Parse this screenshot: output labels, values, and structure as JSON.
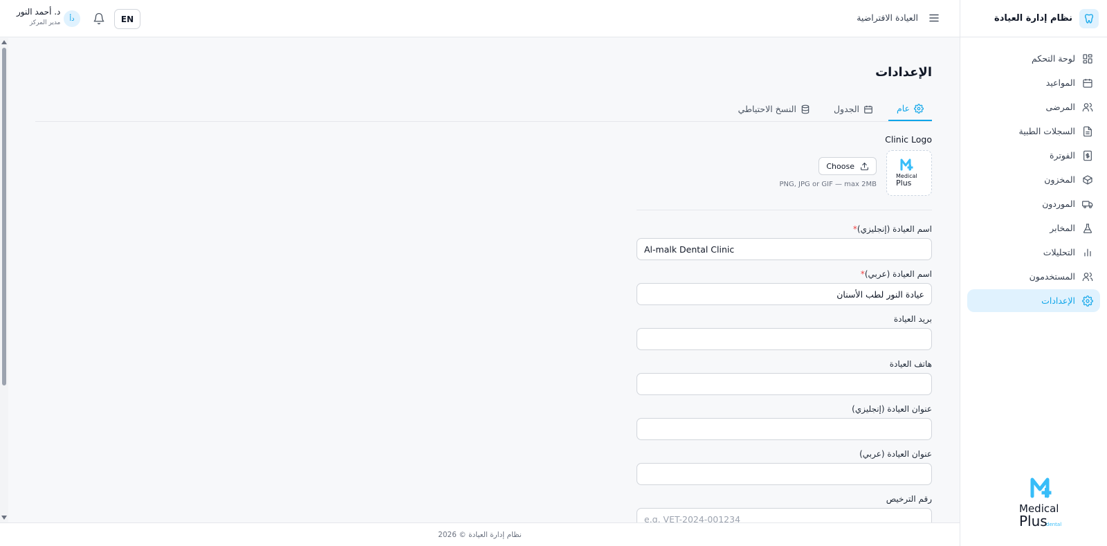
{
  "sidebar": {
    "app_title": "نظام إدارة العيادة",
    "items": [
      {
        "label": "لوحة التحكم",
        "icon": "dashboard-icon"
      },
      {
        "label": "المواعيد",
        "icon": "calendar-icon"
      },
      {
        "label": "المرضى",
        "icon": "patients-icon"
      },
      {
        "label": "السجلات الطبية",
        "icon": "document-icon"
      },
      {
        "label": "الفوترة",
        "icon": "dollar-icon"
      },
      {
        "label": "المخزون",
        "icon": "box-icon"
      },
      {
        "label": "الموردون",
        "icon": "truck-icon"
      },
      {
        "label": "المخابر",
        "icon": "flask-icon"
      },
      {
        "label": "التحليلات",
        "icon": "bar-chart-icon"
      },
      {
        "label": "المستخدمون",
        "icon": "users-icon"
      },
      {
        "label": "الإعدادات",
        "icon": "gear-icon",
        "active": true
      }
    ],
    "brand_line1": "Medical",
    "brand_line2": "Plus",
    "brand_tag": "dental"
  },
  "topbar": {
    "clinic_name": "العيادة الافتراضية",
    "user_name": "د. أحمد النور",
    "user_role": "مدير المركز",
    "avatar_initials": "دأ",
    "lang_button": "EN"
  },
  "main": {
    "title": "الإعدادات",
    "tabs": [
      {
        "label": "عام",
        "icon": "gear-icon",
        "active": true
      },
      {
        "label": "الجدول",
        "icon": "calendar-icon"
      },
      {
        "label": "النسخ الاحتياطي",
        "icon": "database-icon"
      }
    ],
    "logo_label": "Clinic Logo",
    "choose_label": "Choose",
    "logo_hint": "PNG, JPG or GIF — max 2MB",
    "fields": {
      "name_en": {
        "label": "اسم العيادة (إنجليزي)",
        "value": "Al-malk Dental Clinic",
        "required": "*"
      },
      "name_ar": {
        "label": "اسم العيادة (عربي)",
        "value": "عيادة النور لطب الأسنان",
        "required": "*"
      },
      "email": {
        "label": "بريد العيادة",
        "value": ""
      },
      "phone": {
        "label": "هاتف العيادة",
        "value": ""
      },
      "address_en": {
        "label": "عنوان العيادة (إنجليزي)",
        "value": ""
      },
      "address_ar": {
        "label": "عنوان العيادة (عربي)",
        "value": ""
      },
      "license": {
        "label": "رقم الترخيص",
        "placeholder": "e.g. VET-2024-001234"
      }
    }
  },
  "footer": {
    "text": "نظام إدارة العيادة © 2026"
  },
  "colors": {
    "accent": "#0ea5e9",
    "accent_bg": "#e0f2fe",
    "required": "#ef4444"
  }
}
